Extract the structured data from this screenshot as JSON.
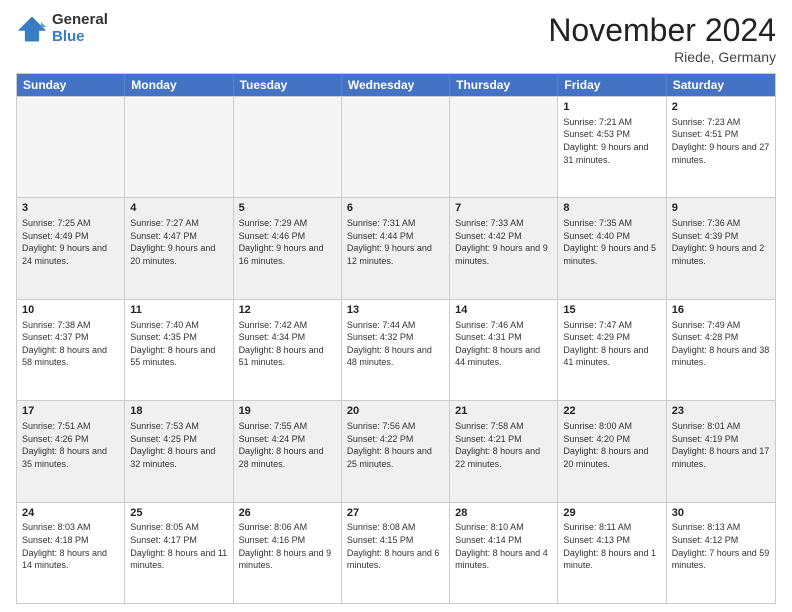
{
  "logo": {
    "general": "General",
    "blue": "Blue"
  },
  "title": "November 2024",
  "location": "Riede, Germany",
  "header": {
    "days": [
      "Sunday",
      "Monday",
      "Tuesday",
      "Wednesday",
      "Thursday",
      "Friday",
      "Saturday"
    ]
  },
  "weeks": [
    [
      {
        "day": "",
        "info": "",
        "empty": true
      },
      {
        "day": "",
        "info": "",
        "empty": true
      },
      {
        "day": "",
        "info": "",
        "empty": true
      },
      {
        "day": "",
        "info": "",
        "empty": true
      },
      {
        "day": "",
        "info": "",
        "empty": true
      },
      {
        "day": "1",
        "info": "Sunrise: 7:21 AM\nSunset: 4:53 PM\nDaylight: 9 hours and 31 minutes."
      },
      {
        "day": "2",
        "info": "Sunrise: 7:23 AM\nSunset: 4:51 PM\nDaylight: 9 hours and 27 minutes."
      }
    ],
    [
      {
        "day": "3",
        "info": "Sunrise: 7:25 AM\nSunset: 4:49 PM\nDaylight: 9 hours and 24 minutes."
      },
      {
        "day": "4",
        "info": "Sunrise: 7:27 AM\nSunset: 4:47 PM\nDaylight: 9 hours and 20 minutes."
      },
      {
        "day": "5",
        "info": "Sunrise: 7:29 AM\nSunset: 4:46 PM\nDaylight: 9 hours and 16 minutes."
      },
      {
        "day": "6",
        "info": "Sunrise: 7:31 AM\nSunset: 4:44 PM\nDaylight: 9 hours and 12 minutes."
      },
      {
        "day": "7",
        "info": "Sunrise: 7:33 AM\nSunset: 4:42 PM\nDaylight: 9 hours and 9 minutes."
      },
      {
        "day": "8",
        "info": "Sunrise: 7:35 AM\nSunset: 4:40 PM\nDaylight: 9 hours and 5 minutes."
      },
      {
        "day": "9",
        "info": "Sunrise: 7:36 AM\nSunset: 4:39 PM\nDaylight: 9 hours and 2 minutes."
      }
    ],
    [
      {
        "day": "10",
        "info": "Sunrise: 7:38 AM\nSunset: 4:37 PM\nDaylight: 8 hours and 58 minutes."
      },
      {
        "day": "11",
        "info": "Sunrise: 7:40 AM\nSunset: 4:35 PM\nDaylight: 8 hours and 55 minutes."
      },
      {
        "day": "12",
        "info": "Sunrise: 7:42 AM\nSunset: 4:34 PM\nDaylight: 8 hours and 51 minutes."
      },
      {
        "day": "13",
        "info": "Sunrise: 7:44 AM\nSunset: 4:32 PM\nDaylight: 8 hours and 48 minutes."
      },
      {
        "day": "14",
        "info": "Sunrise: 7:46 AM\nSunset: 4:31 PM\nDaylight: 8 hours and 44 minutes."
      },
      {
        "day": "15",
        "info": "Sunrise: 7:47 AM\nSunset: 4:29 PM\nDaylight: 8 hours and 41 minutes."
      },
      {
        "day": "16",
        "info": "Sunrise: 7:49 AM\nSunset: 4:28 PM\nDaylight: 8 hours and 38 minutes."
      }
    ],
    [
      {
        "day": "17",
        "info": "Sunrise: 7:51 AM\nSunset: 4:26 PM\nDaylight: 8 hours and 35 minutes."
      },
      {
        "day": "18",
        "info": "Sunrise: 7:53 AM\nSunset: 4:25 PM\nDaylight: 8 hours and 32 minutes."
      },
      {
        "day": "19",
        "info": "Sunrise: 7:55 AM\nSunset: 4:24 PM\nDaylight: 8 hours and 28 minutes."
      },
      {
        "day": "20",
        "info": "Sunrise: 7:56 AM\nSunset: 4:22 PM\nDaylight: 8 hours and 25 minutes."
      },
      {
        "day": "21",
        "info": "Sunrise: 7:58 AM\nSunset: 4:21 PM\nDaylight: 8 hours and 22 minutes."
      },
      {
        "day": "22",
        "info": "Sunrise: 8:00 AM\nSunset: 4:20 PM\nDaylight: 8 hours and 20 minutes."
      },
      {
        "day": "23",
        "info": "Sunrise: 8:01 AM\nSunset: 4:19 PM\nDaylight: 8 hours and 17 minutes."
      }
    ],
    [
      {
        "day": "24",
        "info": "Sunrise: 8:03 AM\nSunset: 4:18 PM\nDaylight: 8 hours and 14 minutes."
      },
      {
        "day": "25",
        "info": "Sunrise: 8:05 AM\nSunset: 4:17 PM\nDaylight: 8 hours and 11 minutes."
      },
      {
        "day": "26",
        "info": "Sunrise: 8:06 AM\nSunset: 4:16 PM\nDaylight: 8 hours and 9 minutes."
      },
      {
        "day": "27",
        "info": "Sunrise: 8:08 AM\nSunset: 4:15 PM\nDaylight: 8 hours and 6 minutes."
      },
      {
        "day": "28",
        "info": "Sunrise: 8:10 AM\nSunset: 4:14 PM\nDaylight: 8 hours and 4 minutes."
      },
      {
        "day": "29",
        "info": "Sunrise: 8:11 AM\nSunset: 4:13 PM\nDaylight: 8 hours and 1 minute."
      },
      {
        "day": "30",
        "info": "Sunrise: 8:13 AM\nSunset: 4:12 PM\nDaylight: 7 hours and 59 minutes."
      }
    ]
  ]
}
